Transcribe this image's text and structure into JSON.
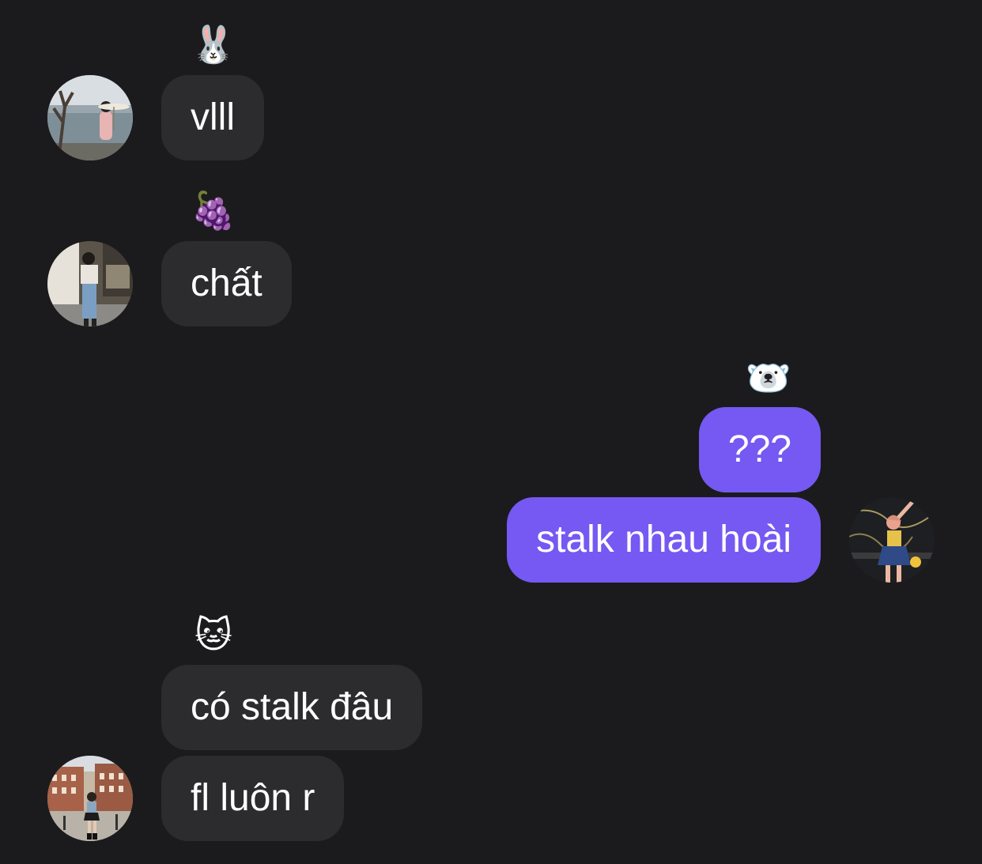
{
  "messages": [
    {
      "sender": "incoming",
      "reaction": "🐰",
      "text": "vlll"
    },
    {
      "sender": "incoming",
      "reaction": "🍇",
      "text": "chất"
    },
    {
      "sender": "outgoing",
      "reaction": "🐻‍❄️",
      "text": "???"
    },
    {
      "sender": "outgoing",
      "reaction": "",
      "text": "stalk nhau hoài"
    },
    {
      "sender": "incoming",
      "reaction": "🐱",
      "text": "có stalk đâu"
    },
    {
      "sender": "incoming",
      "reaction": "",
      "text": "fl luôn r"
    }
  ],
  "colors": {
    "background": "#1b1b1d",
    "incoming_bubble": "#2c2c2f",
    "outgoing_bubble": "#7559f2",
    "text": "#ffffff"
  },
  "avatars": [
    {
      "icon": "avatar-photo-lakeside"
    },
    {
      "icon": "avatar-photo-street"
    },
    {
      "icon": "avatar-photo-self"
    },
    {
      "icon": "avatar-photo-city"
    }
  ]
}
